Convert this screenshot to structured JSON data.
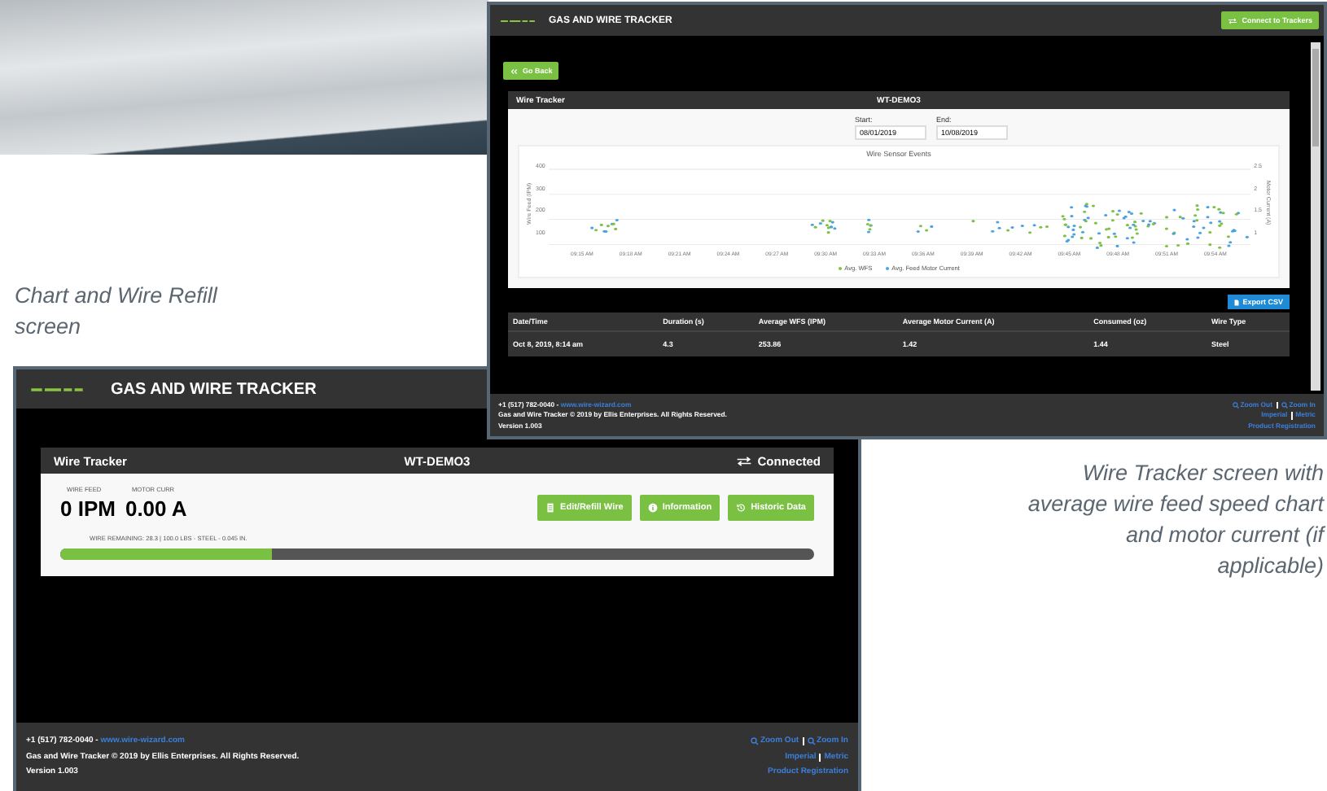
{
  "captions": [
    {
      "text": "Chart and Wire Refill screen",
      "kind": "left"
    },
    {
      "text": "Wire Tracker screen with average wire feed speed chart and motor current (if applicable)",
      "kind": "right"
    }
  ],
  "tracker_screen": {
    "app_title": "GAS AND WIRE TRACKER",
    "header_button": "Connect to Trackers",
    "back_button": "Go Back",
    "panel": {
      "title": "Wire Tracker",
      "device": "WT-DEMO3"
    },
    "date_range": {
      "start_label": "Start:",
      "start_value": "08/01/2019",
      "end_label": "End:",
      "end_value": "10/08/2019"
    },
    "chart": {
      "title": "Wire Sensor Events",
      "y_left_label": "Wire Feed (IPM)",
      "y_right_label": "Motor Current (A)",
      "y_left_ticks": [
        "400",
        "300",
        "200",
        "100"
      ],
      "y_right_ticks": [
        "2.5",
        "2",
        "1.5",
        "1"
      ],
      "x_ticks": [
        "09:15 AM",
        "09:18 AM",
        "09:21 AM",
        "09:24 AM",
        "09:27 AM",
        "09:30 AM",
        "09:33 AM",
        "09:36 AM",
        "09:39 AM",
        "09:42 AM",
        "09:45 AM",
        "09:48 AM",
        "09:51 AM",
        "09:54 AM"
      ],
      "legend": [
        {
          "name": "Avg. WFS",
          "color": "#7dc242"
        },
        {
          "name": "Avg. Feed Motor Current",
          "color": "#4aa3df"
        }
      ]
    },
    "export_button": "Export CSV",
    "table": {
      "columns": [
        "Date/Time",
        "Duration (s)",
        "Average WFS (IPM)",
        "Average Motor Current (A)",
        "Consumed (oz)",
        "Wire Type"
      ],
      "rows": [
        [
          "Oct 8, 2019, 8:14 am",
          "4.3",
          "253.86",
          "1.42",
          "1.44",
          "Steel"
        ]
      ]
    },
    "footer": {
      "phone": "+1 (517) 782-0040 -",
      "website": "www.wire-wizard.com",
      "copyright": "Gas and Wire Tracker © 2019 by Ellis Enterprises. All Rights Reserved.",
      "version": "Version 1.003",
      "link_rows": [
        [
          {
            "label": "Zoom Out",
            "icon": true
          },
          {
            "label": "Zoom In",
            "icon": true
          }
        ],
        [
          {
            "label": "Imperial",
            "icon": false
          },
          {
            "label": "Metric",
            "icon": false
          }
        ],
        [
          {
            "label": "Product Registration",
            "icon": false
          }
        ]
      ]
    }
  },
  "refill_screen": {
    "app_title": "GAS AND WIRE TRACKER",
    "panel": {
      "title": "Wire Tracker",
      "device": "WT-DEMO3",
      "status": "Connected"
    },
    "readings": [
      {
        "label": "WIRE FEED",
        "value": "0 IPM"
      },
      {
        "label": "MOTOR CURR",
        "value": "0.00 A"
      }
    ],
    "buttons": [
      {
        "label": "Edit/Refill Wire",
        "kind": "refill"
      },
      {
        "label": "Information",
        "kind": "info"
      },
      {
        "label": "Historic Data",
        "kind": "history"
      }
    ],
    "remaining": "WIRE REMAINING: 28.3 | 100.0 LBS - STEEL - 0.045 IN.",
    "wire_meter": {
      "level": 0.28
    },
    "footer": {
      "phone": "+1 (517) 782-0040 -",
      "website": "www.wire-wizard.com",
      "copyright": "Gas and Wire Tracker © 2019 by Ellis Enterprises. All Rights Reserved.",
      "version": "Version 1.003",
      "link_rows": [
        [
          {
            "label": "Zoom Out",
            "icon": true
          },
          {
            "label": "Zoom In",
            "icon": true
          }
        ],
        [
          {
            "label": "Imperial",
            "icon": false
          },
          {
            "label": "Metric",
            "icon": false
          }
        ],
        [
          {
            "label": "Product Registration",
            "icon": false
          }
        ]
      ]
    }
  }
}
